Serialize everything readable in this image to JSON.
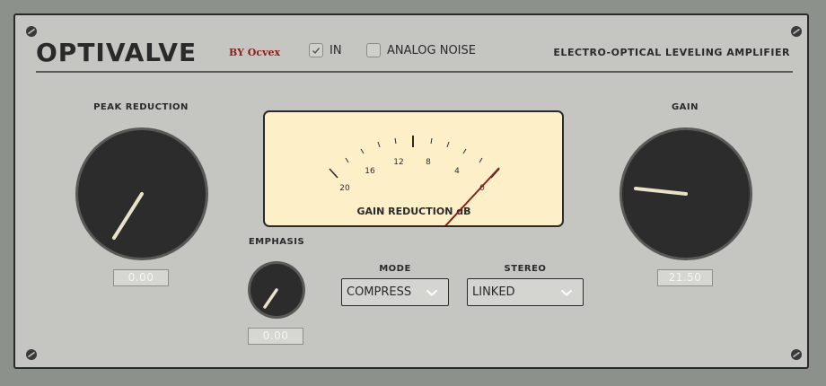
{
  "header": {
    "title": "OPTIVALVE",
    "by": "BY Ocvex",
    "subtitle": "ELECTRO-OPTICAL LEVELING AMPLIFIER"
  },
  "toggles": {
    "in": {
      "label": "IN",
      "checked": true
    },
    "analog_noise": {
      "label": "ANALOG NOISE",
      "checked": false
    }
  },
  "peak_reduction": {
    "label": "PEAK REDUCTION",
    "value": "0.00"
  },
  "gain": {
    "label": "GAIN",
    "value": "21.50"
  },
  "emphasis": {
    "label": "EMPHASIS",
    "value": "0.00"
  },
  "meter": {
    "label": "GAIN REDUCTION dB",
    "scale_labels": [
      "20",
      "16",
      "12",
      "8",
      "4",
      "0"
    ]
  },
  "mode": {
    "label": "MODE",
    "selected": "COMPRESS"
  },
  "stereo": {
    "label": "STEREO",
    "selected": "LINKED"
  },
  "colors": {
    "panel": "#c5c6c1",
    "background": "#8d918b",
    "knob": "#2b2c2b",
    "pointer": "#e9e2c8",
    "meter_face": "#fdf0c9",
    "needle": "#8b1e1e",
    "brand": "#8b1e1e"
  }
}
